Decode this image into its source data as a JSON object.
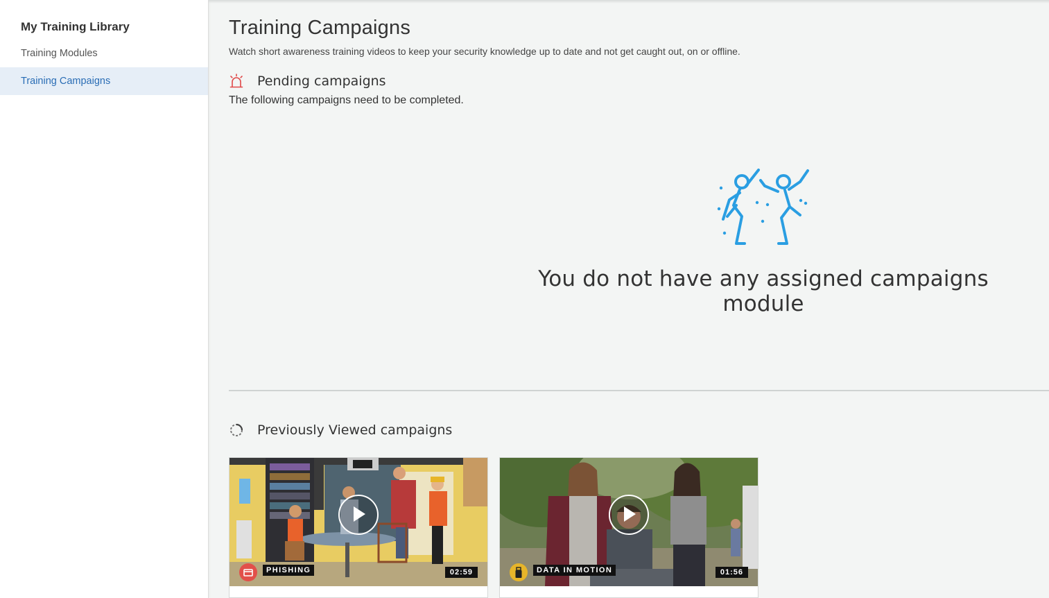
{
  "sidebar": {
    "title": "My Training Library",
    "items": [
      {
        "label": "Training Modules",
        "active": false
      },
      {
        "label": "Training Campaigns",
        "active": true
      }
    ]
  },
  "main": {
    "title": "Training Campaigns",
    "subtitle": "Watch short awareness training videos to keep your security knowledge up to date and not get caught out, on or offline.",
    "pending": {
      "icon": "alarm-siren-icon",
      "label": "Pending campaigns",
      "description": "The following campaigns need to be completed.",
      "empty_icon": "celebrating-people-icon",
      "empty_message": "You do not have any assigned campaigns module"
    },
    "previous": {
      "icon": "history-icon",
      "label": "Previously Viewed campaigns",
      "cards": [
        {
          "category": "PHISHING",
          "category_icon": "phishing-icon",
          "duration": "02:59"
        },
        {
          "category": "DATA IN MOTION",
          "category_icon": "usb-drive-icon",
          "duration": "01:56"
        }
      ]
    }
  },
  "colors": {
    "accent": "#2a6db5",
    "active_bg": "#e6eef7",
    "illustration": "#2a9ee2",
    "alert": "#e04848",
    "page_bg": "#f3f5f4"
  }
}
